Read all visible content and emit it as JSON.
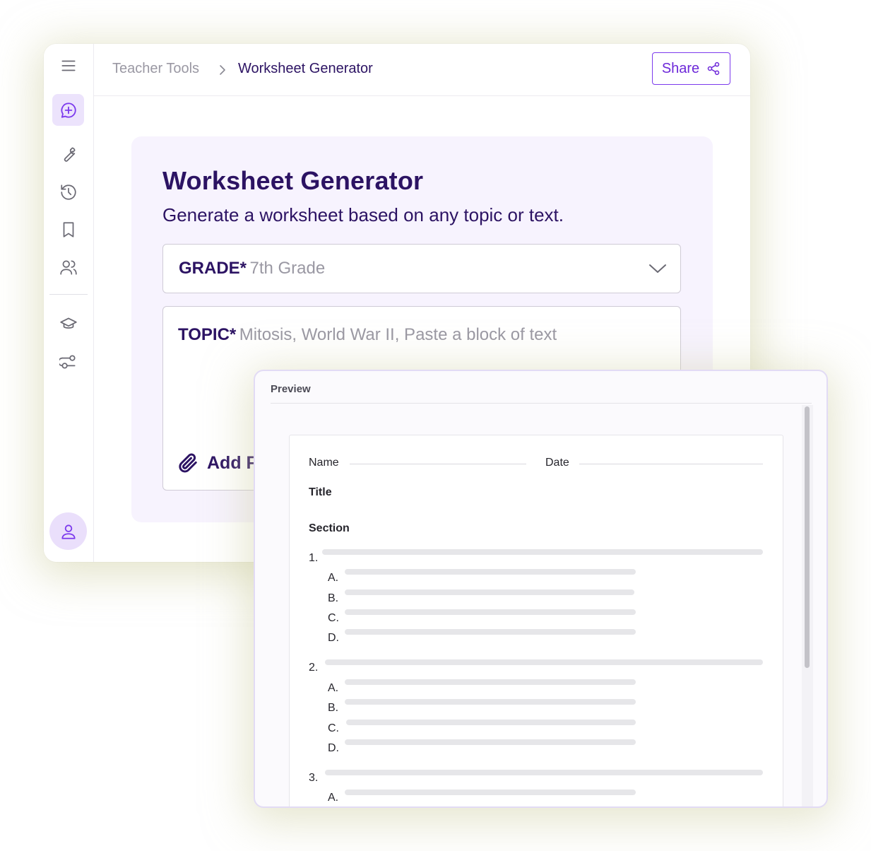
{
  "breadcrumb": {
    "root": "Teacher Tools",
    "current": "Worksheet Generator"
  },
  "share": {
    "label": "Share"
  },
  "form": {
    "title": "Worksheet Generator",
    "subtitle": "Generate a worksheet based on any topic or text.",
    "grade": {
      "label": "GRADE*",
      "value": "7th Grade"
    },
    "topic": {
      "label": "TOPIC*",
      "placeholder": "Mitosis, World War II, Paste a block of text"
    },
    "attach_label": "Add F"
  },
  "preview": {
    "header": "Preview",
    "name_label": "Name",
    "date_label": "Date",
    "title_label": "Title",
    "section_label": "Section",
    "questions": [
      {
        "number": "1.",
        "options": [
          "A.",
          "B.",
          "C.",
          "D."
        ]
      },
      {
        "number": "2.",
        "options": [
          "A.",
          "B.",
          "C.",
          "D."
        ]
      },
      {
        "number": "3.",
        "options": [
          "A."
        ]
      }
    ]
  },
  "colors": {
    "brand_dark": "#2c1363",
    "accent": "#7c3aed",
    "accent_light": "#ece3fc",
    "card_bg": "#f7f3fe"
  },
  "icons": {
    "sidebar": [
      "menu-icon",
      "new-chat-icon",
      "wrench-icon",
      "history-icon",
      "bookmark-icon",
      "users-icon",
      "graduation-cap-icon",
      "integrations-icon"
    ],
    "avatar": "user-icon",
    "share": "share-icon",
    "grade_dropdown": "chevron-down-icon",
    "attach": "paperclip-icon"
  }
}
